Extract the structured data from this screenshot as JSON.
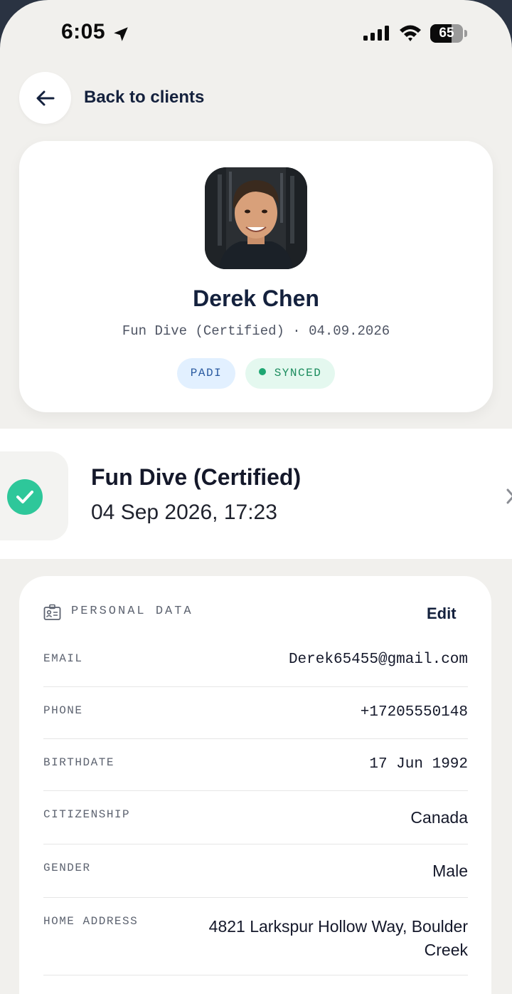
{
  "status_bar": {
    "time": "6:05",
    "battery_percent": 65,
    "battery_label": "65"
  },
  "nav": {
    "back_label": "Back to clients"
  },
  "profile": {
    "name": "Derek Chen",
    "meta": "Fun Dive (Certified) · 04.09.2026",
    "badges": {
      "agency": "PADI",
      "sync_status": "SYNCED"
    }
  },
  "dive": {
    "title": "Fun Dive (Certified)",
    "datetime": "04 Sep 2026, 17:23"
  },
  "personal_data": {
    "title": "PERSONAL DATA",
    "edit_label": "Edit",
    "fields": [
      {
        "label": "EMAIL",
        "value": "Derek65455@gmail.com"
      },
      {
        "label": "PHONE",
        "value": "+17205550148"
      },
      {
        "label": "BIRTHDATE",
        "value": "17 Jun 1992"
      },
      {
        "label": "CITIZENSHIP",
        "value": "Canada"
      },
      {
        "label": "GENDER",
        "value": "Male"
      },
      {
        "label": "HOME ADDRESS",
        "value": "4821 Larkspur Hollow Way, Boulder Creek"
      }
    ]
  },
  "colors": {
    "background": "#f1f0ed",
    "text_primary": "#14213d",
    "success": "#2ec79a",
    "badge_padi_bg": "#e2f0ff",
    "badge_synced_bg": "#e4f8ef"
  }
}
